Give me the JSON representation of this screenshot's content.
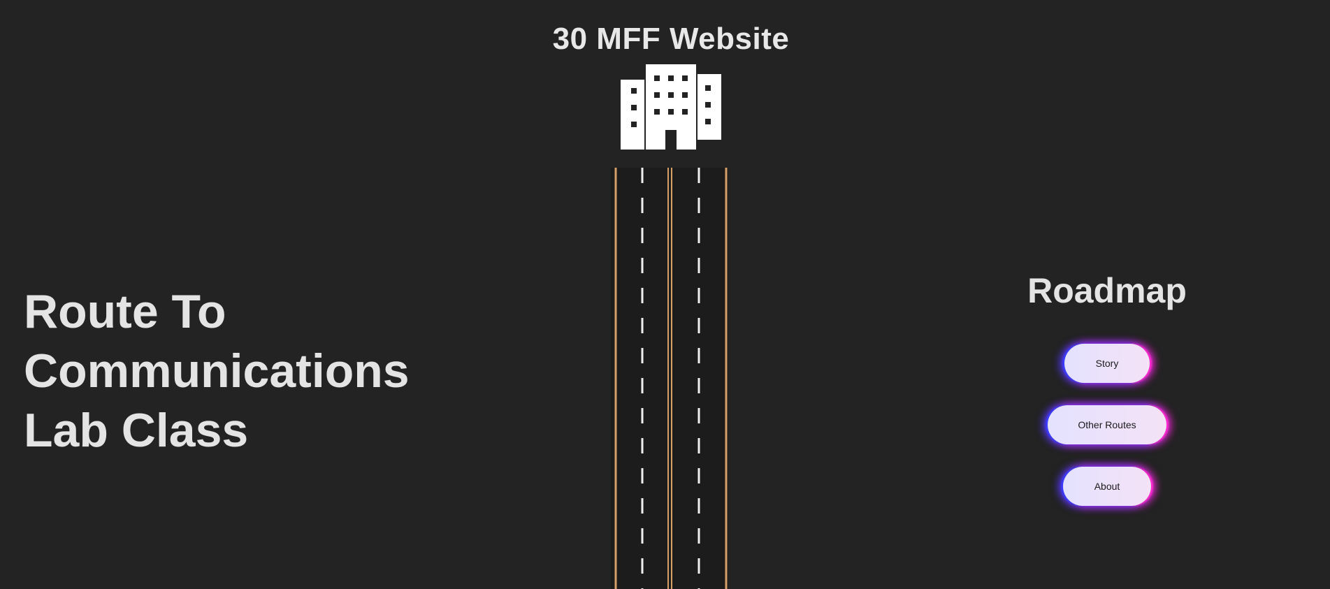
{
  "header": {
    "title": "30 MFF Website"
  },
  "hero": {
    "lines": [
      "Route To",
      "Communications",
      "Lab Class"
    ]
  },
  "roadmap": {
    "title": "Roadmap",
    "buttons": {
      "story": "Story",
      "other_routes": "Other Routes",
      "about": "About"
    }
  },
  "icons": {
    "building": "office-building-icon",
    "road": "road-illustration"
  },
  "colors": {
    "background": "#232323",
    "text": "#e6e6e6",
    "road_edge": "#d9a066",
    "lane_dash": "#f0f0f0",
    "glow_blue": "#3b3bff",
    "glow_pink": "#ff2ad0"
  }
}
